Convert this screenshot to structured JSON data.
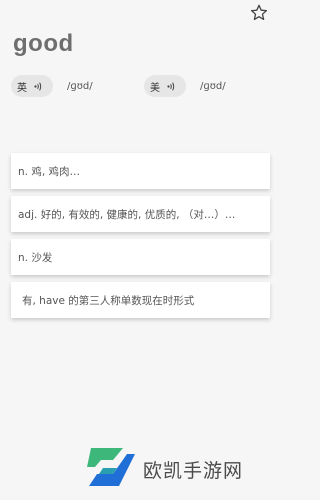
{
  "word": "good",
  "pronunciations": [
    {
      "label": "英",
      "phonetic": "/ɡʊd/"
    },
    {
      "label": "美",
      "phonetic": "/ɡʊd/"
    }
  ],
  "definitions": [
    "n. 鸡, 鸡肉…",
    "adj. 好的, 有效的, 健康的, 优质的, （对…）…",
    "n. 沙发",
    "有, have 的第三人称单数现在时形式"
  ],
  "watermark": {
    "text": "欧凯手游网"
  },
  "icons": {
    "favorite": "star-outline-icon",
    "speaker": "speaker-icon",
    "logo": "site-logo-icon"
  },
  "colors": {
    "background": "#f6f6f6",
    "pill": "#e6e6e6",
    "card": "#ffffff",
    "logo_green": "#3db87a",
    "logo_blue": "#1f6fd6"
  }
}
